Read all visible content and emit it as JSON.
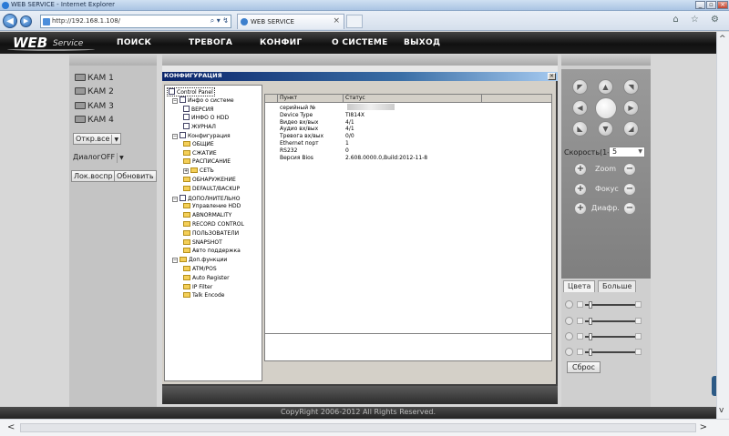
{
  "browser": {
    "title": "WEB SERVICE - Internet Explorer",
    "url": "http://192.168.1.108/",
    "tab_title": "WEB SERVICE",
    "tab_close": "×",
    "search_tools": "⌕ ▾ ↯",
    "win_min": "_",
    "win_max": "▫",
    "win_close": "×",
    "back": "◀",
    "forward": "▶",
    "right_icons": "⌂ ☆ ⚙"
  },
  "app": {
    "logo_main": "WEB",
    "logo_sub": "Service",
    "menu": [
      "ПОИСК",
      "ТРЕВОГА",
      "КОНФИГ",
      "О СИСТЕМЕ",
      "ВЫХОД"
    ],
    "footer": "CopyRight 2006-2012 All Rights Reserved."
  },
  "cameras": [
    "КАМ 1",
    "КАМ 2",
    "КАМ 3",
    "КАМ 4"
  ],
  "left_controls": {
    "open_all": "Откр.все",
    "dialog": "ДиалогOFF",
    "local_play": "Лок.воспр",
    "refresh": "Обновить",
    "dd_arrow": "▼"
  },
  "config_dialog": {
    "title": "КОНФИГУРАЦИЯ",
    "close": "×",
    "tree": [
      {
        "label": "Control Panel",
        "level": 0,
        "icon": "panel-icon"
      },
      {
        "label": "Инфо о системе",
        "level": 1,
        "icon": "info-icon",
        "toggle": "−"
      },
      {
        "label": "ВЕРСИЯ",
        "level": 2,
        "icon": "doc-icon"
      },
      {
        "label": "ИНФО О HDD",
        "level": 2,
        "icon": "doc-icon"
      },
      {
        "label": "ЖУРНАЛ",
        "level": 2,
        "icon": "doc-icon"
      },
      {
        "label": "Конфигурация",
        "level": 1,
        "icon": "config-icon",
        "toggle": "−"
      },
      {
        "label": "ОБЩИЕ",
        "level": 2,
        "icon": "folder-icon"
      },
      {
        "label": "СЖАТИЕ",
        "level": 2,
        "icon": "folder-icon"
      },
      {
        "label": "РАСПИСАНИЕ",
        "level": 2,
        "icon": "folder-icon"
      },
      {
        "label": "СЕТЬ",
        "level": 2,
        "icon": "folder-icon",
        "toggle": "+"
      },
      {
        "label": "ОБНАРУЖЕНИЕ",
        "level": 2,
        "icon": "folder-icon"
      },
      {
        "label": "DEFAULT/BACKUP",
        "level": 2,
        "icon": "folder-icon"
      },
      {
        "label": "ДОПОЛНИТЕЛЬНО",
        "level": 1,
        "icon": "advanced-icon",
        "toggle": "−"
      },
      {
        "label": "Управление HDD",
        "level": 2,
        "icon": "folder-icon"
      },
      {
        "label": "ABNORMALITY",
        "level": 2,
        "icon": "folder-icon"
      },
      {
        "label": "RECORD CONTROL",
        "level": 2,
        "icon": "folder-icon"
      },
      {
        "label": "ПОЛЬЗОВАТЕЛИ",
        "level": 2,
        "icon": "folder-icon"
      },
      {
        "label": "SNAPSHOT",
        "level": 2,
        "icon": "folder-icon"
      },
      {
        "label": "Авто поддержка",
        "level": 2,
        "icon": "folder-icon"
      },
      {
        "label": "Доп.функции",
        "level": 1,
        "icon": "folder-icon",
        "toggle": "−"
      },
      {
        "label": "ATM/POS",
        "level": 2,
        "icon": "folder-icon"
      },
      {
        "label": "Auto Register",
        "level": 2,
        "icon": "folder-icon"
      },
      {
        "label": "IP Filter",
        "level": 2,
        "icon": "folder-icon"
      },
      {
        "label": "Talk Encode",
        "level": 2,
        "icon": "folder-icon"
      }
    ],
    "columns": [
      "Пункт",
      "Статус"
    ],
    "rows": [
      [
        "серийный №",
        ""
      ],
      [
        "Device Type",
        "TI814X"
      ],
      [
        "Видео вх/вых",
        "4/1"
      ],
      [
        "Аудио вх/вых",
        "4/1"
      ],
      [
        "Тревога вх/вых",
        "0/0"
      ],
      [
        "Ethernet порт",
        "1"
      ],
      [
        "RS232",
        "0"
      ],
      [
        "Версия Bios",
        "2.608.0000.0,Build:2012-11-8"
      ]
    ]
  },
  "ptz": {
    "arrows": [
      "◤",
      "▲",
      "◥",
      "◀",
      "",
      "▶",
      "◣",
      "▼",
      "◢"
    ],
    "speed_label": "Скорость(1-",
    "speed_value": "5",
    "zoom": "Zoom",
    "focus": "Фокус",
    "iris": "Диафр.",
    "plus": "+",
    "minus": "−",
    "tabs": [
      "Цвета",
      "Больше"
    ],
    "reset": "Сброс"
  }
}
